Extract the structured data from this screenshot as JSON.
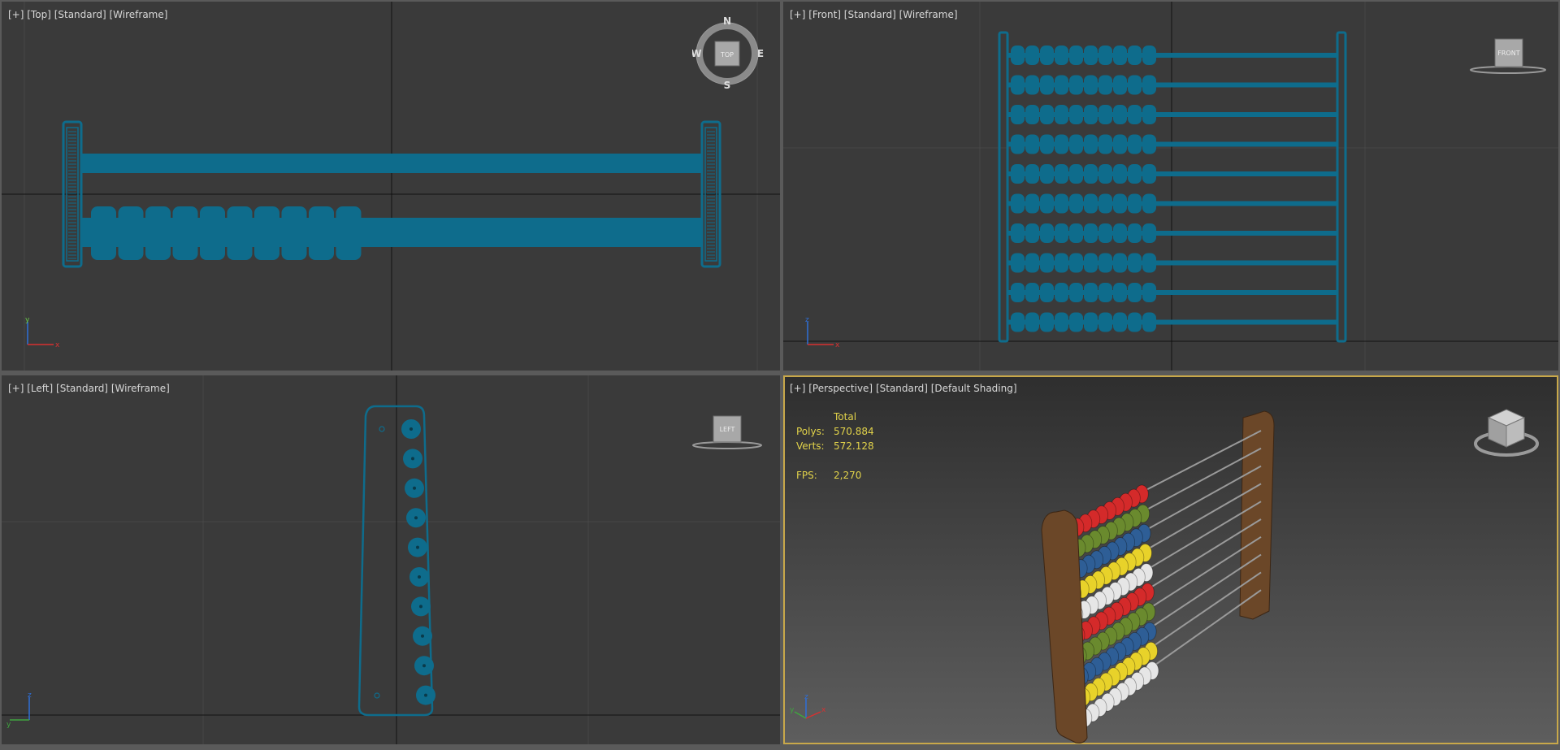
{
  "viewports": {
    "top": {
      "menu": "[+]",
      "view": "[Top]",
      "quality": "[Standard]",
      "shading": "[Wireframe]",
      "cube_face": "TOP",
      "compass": {
        "n": "N",
        "s": "S",
        "e": "E",
        "w": "W"
      },
      "axis": {
        "up": "y",
        "right": "x"
      }
    },
    "front": {
      "menu": "[+]",
      "view": "[Front]",
      "quality": "[Standard]",
      "shading": "[Wireframe]",
      "cube_face": "FRONT",
      "axis": {
        "up": "z",
        "right": "x"
      }
    },
    "left": {
      "menu": "[+]",
      "view": "[Left]",
      "quality": "[Standard]",
      "shading": "[Wireframe]",
      "cube_face": "LEFT",
      "axis": {
        "up": "z",
        "right": "y"
      }
    },
    "perspective": {
      "menu": "[+]",
      "view": "[Perspective]",
      "quality": "[Standard]",
      "shading": "[Default Shading]",
      "axis": {
        "up": "z",
        "right": "x",
        "left": "y"
      },
      "stats": {
        "header": "Total",
        "polys_label": "Polys:",
        "polys_value": "570.884",
        "verts_label": "Verts:",
        "verts_value": "572.128",
        "fps_label": "FPS:",
        "fps_value": "2,270"
      }
    }
  },
  "colors": {
    "wire": "#0e6c8c",
    "stat_text": "#e2d34a",
    "active_border": "#c8a84a",
    "bead_red": "#d42a2a",
    "bead_green": "#6a8a2e",
    "bead_blue": "#2e5e96",
    "bead_yellow": "#e8d22a",
    "bead_white": "#e6e6e6",
    "frame_wood": "#6b4728"
  }
}
